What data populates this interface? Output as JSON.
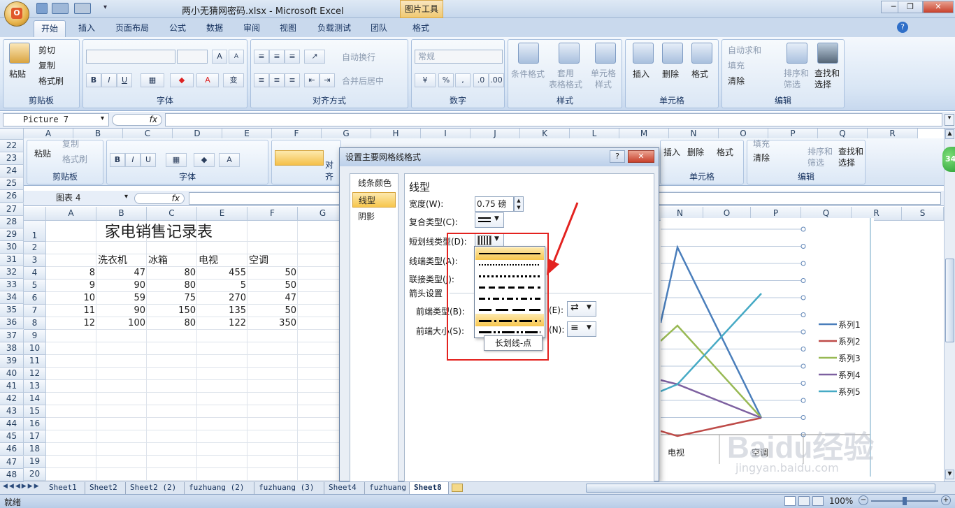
{
  "window": {
    "title": "两小无猜网密码.xlsx - Microsoft Excel",
    "tool_tab": "图片工具",
    "minimize": "─",
    "maximize": "❐",
    "close": "✕",
    "office_letter": "O"
  },
  "ribbon_tabs": [
    "开始",
    "插入",
    "页面布局",
    "公式",
    "数据",
    "审阅",
    "视图",
    "负载测试",
    "团队",
    "格式"
  ],
  "ribbon": {
    "clipboard": {
      "label": "剪贴板",
      "paste": "粘贴",
      "cut": "剪切",
      "copy": "复制",
      "format_painter": "格式刷"
    },
    "font": {
      "label": "字体",
      "bold": "B",
      "italic": "I",
      "underline": "U",
      "grow": "A",
      "shrink": "A",
      "wen": "变"
    },
    "alignment": {
      "label": "对齐方式",
      "wrap": "自动换行",
      "merge": "合并后居中"
    },
    "number": {
      "label": "数字",
      "format": "常规",
      "percent": "%",
      "comma": ","
    },
    "styles": {
      "label": "样式",
      "cond_format": "条件格式",
      "table_format": "套用\n表格格式",
      "cell_styles": "单元格\n样式"
    },
    "cells": {
      "label": "单元格",
      "insert": "插入",
      "delete": "删除",
      "format": "格式"
    },
    "editing": {
      "label": "编辑",
      "autosum": "自动求和",
      "fill": "填充",
      "clear": "清除",
      "sort": "排序和\n筛选",
      "find": "查找和\n选择"
    }
  },
  "formula_bar": {
    "name_box": "Picture 7",
    "fx": "fx",
    "value": ""
  },
  "columns": [
    "A",
    "B",
    "C",
    "D",
    "E",
    "F",
    "G",
    "H",
    "I",
    "J",
    "K",
    "L",
    "M",
    "N",
    "O",
    "P",
    "Q",
    "R"
  ],
  "outer_rows": [
    "22",
    "23",
    "24",
    "25",
    "26",
    "27",
    "28",
    "29",
    "30",
    "31",
    "32",
    "33",
    "34",
    "35",
    "36",
    "37",
    "38",
    "39",
    "40",
    "41",
    "42",
    "43",
    "44",
    "45",
    "46",
    "47",
    "48"
  ],
  "inner": {
    "name_box": "图表 4",
    "fx": "fx",
    "columns": [
      "A",
      "B",
      "C",
      "E",
      "F",
      "G"
    ],
    "chart_columns": [
      "N",
      "O",
      "P",
      "Q",
      "R",
      "S"
    ],
    "rows": [
      "1",
      "2",
      "3",
      "4",
      "5",
      "6",
      "7",
      "8",
      "9",
      "10",
      "11",
      "12",
      "13",
      "14",
      "15",
      "16",
      "17",
      "18",
      "19",
      "20"
    ],
    "ribbon": {
      "paste": "粘贴",
      "copy": "复制",
      "format_painter": "格式刷",
      "clipboard": "剪贴板",
      "font": "字体",
      "align": "对齐",
      "insert": "插入",
      "delete": "删除",
      "format": "格式",
      "cells": "单元格",
      "clear": "清除",
      "fill": "填充",
      "sort": "排序和\n筛选",
      "find": "查找和\n选择",
      "edit": "编辑"
    }
  },
  "sheet": {
    "title": "家电销售记录表",
    "headers": [
      "洗衣机",
      "冰箱",
      "电视",
      "空调"
    ],
    "rows": [
      {
        "a": "8",
        "b": "47",
        "c": "80",
        "e": "455",
        "f": "50"
      },
      {
        "a": "9",
        "b": "90",
        "c": "80",
        "e": "5",
        "f": "50"
      },
      {
        "a": "10",
        "b": "59",
        "c": "75",
        "e": "270",
        "f": "47"
      },
      {
        "a": "11",
        "b": "90",
        "c": "150",
        "e": "135",
        "f": "50"
      },
      {
        "a": "12",
        "b": "100",
        "c": "80",
        "e": "122",
        "f": "350"
      }
    ]
  },
  "chart": {
    "legend": [
      "系列1",
      "系列2",
      "系列3",
      "系列4",
      "系列5"
    ],
    "x_visible": [
      "电视",
      "空调"
    ],
    "colors": [
      "#4a7ebb",
      "#be4b48",
      "#98b954",
      "#7d60a0",
      "#46aac5"
    ]
  },
  "dialog": {
    "title": "设置主要网格线格式",
    "help": "?",
    "close": "✕",
    "nav": [
      "线条颜色",
      "线型",
      "阴影"
    ],
    "section": "线型",
    "width_label": "宽度(W):",
    "width_value": "0.75 磅",
    "compound_label": "复合类型(C):",
    "dash_label": "短划线类型(D):",
    "cap_label": "线端类型(A):",
    "join_label": "联接类型(J):",
    "arrow_section": "箭头设置",
    "begin_type_label": "前端类型(B):",
    "begin_size_label": "前端大小(S):",
    "end_type_suffix": "(E):",
    "end_size_suffix": "(N):",
    "tooltip": "长划线-点"
  },
  "sheet_tabs": [
    "Sheet1",
    "Sheet2",
    "Sheet2 (2)",
    "fuzhuang (2)",
    "fuzhuang (3)",
    "Sheet4",
    "fuzhuang",
    "Sheet8"
  ],
  "status": {
    "ready": "就绪",
    "zoom": "100%"
  },
  "watermark": {
    "brand": "Baidu经验",
    "url": "jingyan.baidu.com"
  },
  "badge": "34"
}
